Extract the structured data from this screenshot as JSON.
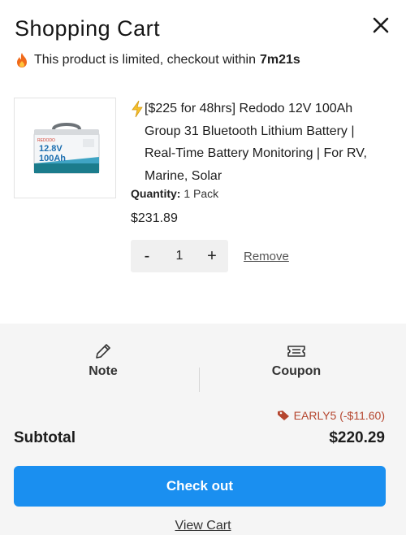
{
  "header": {
    "title": "Shopping Cart"
  },
  "limited": {
    "text": "This product is limited, checkout within",
    "time": "7m21s"
  },
  "item": {
    "title": "[$225 for 48hrs] Redodo 12V 100Ah Group 31 Bluetooth Lithium Battery | Real-Time Battery Monitoring | For RV, Marine, Solar",
    "quantity_label": "Quantity:",
    "quantity_value": "1 Pack",
    "price": "$231.89",
    "qty": "1",
    "minus": "-",
    "plus": "+",
    "remove": "Remove",
    "image_text": {
      "brand": "REDODO",
      "voltage": "12.8V",
      "capacity": "100Ah"
    }
  },
  "footer": {
    "note_label": "Note",
    "coupon_label": "Coupon",
    "discount": "EARLY5 (-$11.60)",
    "subtotal_label": "Subtotal",
    "subtotal_value": "$220.29",
    "checkout": "Check out",
    "view_cart": "View Cart"
  },
  "colors": {
    "accent": "#1a8ff0",
    "discount": "#b5452e"
  },
  "icons": [
    "close-icon",
    "fire-icon",
    "bolt-icon",
    "pencil-icon",
    "ticket-icon",
    "tag-icon"
  ]
}
